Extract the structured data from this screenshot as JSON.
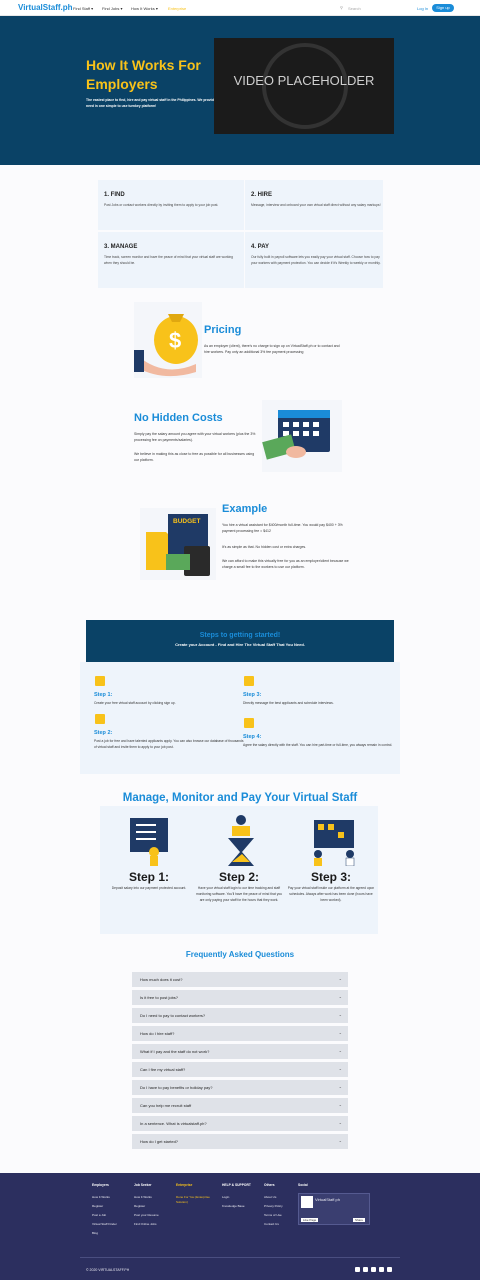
{
  "nav": {
    "logo_a": "Virtual",
    "logo_b": "Staff.ph",
    "menu": [
      "Find Staff ▾",
      "Find Jobs ▾",
      "How It Works ▾",
      "Enterprise"
    ],
    "search_placeholder": "Search",
    "login": "Log In",
    "signup": "Sign up"
  },
  "hero": {
    "title": "How It Works For Employers",
    "subtitle": "The easiest place to find, hire and pay virtual staff in the Philippines. We provide everything you need in one simple to use turnkey platform!",
    "video": "VIDEO PLACEHOLDER"
  },
  "cards": [
    {
      "title": "1. FIND",
      "text": "Post Jobs or contact workers directly by inviting them to apply to your job post."
    },
    {
      "title": "2. HIRE",
      "text": "Message, interview and onboard your own virtual staff direct without any salary markups!"
    },
    {
      "title": "3. MANAGE",
      "text": "Time track, screen monitor and have the peace of mind that your virtual staff are working when they should be."
    },
    {
      "title": "4. PAY",
      "text": "Our fully built in payroll software lets you easily pay your virtual staff. Choose how to pay your workers with payment protection. You can decide if it's Weekly to weekly or monthly."
    }
  ],
  "pricing": {
    "title": "Pricing",
    "text": "As an employer (client), there's no charge to sign up on VirtualStaff.ph or to contact and hire workers. Pay only an additional 3% fee payment processing"
  },
  "hidden": {
    "title": "No Hidden Costs",
    "p1": "Simply pay the salary amount you agree with your virtual workers (plus the 3% processing fee on payments/salaries).",
    "p2": "We believe in making this as close to free as possible for all businesses using our platform."
  },
  "example": {
    "title": "Example",
    "p1": "You hire a virtual assistant for $400/month full-time. You would pay $400 + 3% payment processing fee = $412",
    "p2": "It's as simple as that. No hidden cost or extra charges.",
    "p3": "We can afford to make this virtually free for you as an employer/client because we charge a small fee to the workers to use our platform.",
    "budget": "BUDGET"
  },
  "getting": {
    "title": "Steps to getting started!",
    "sub": "Create your Account - Find and Hire The Virtual Staff That You Need.",
    "steps": [
      {
        "h": "Step 1:",
        "t": "Create your free virtual staff account by clicking sign up."
      },
      {
        "h": "Step 2:",
        "t": "Post a job for free and have talented applicants apply. You can also browse our database of thousands of virtual staff and invite them to apply to your job post."
      },
      {
        "h": "Step 3:",
        "t": "Directly message the best applicants and schedule interviews."
      },
      {
        "h": "Step 4:",
        "t": "Agree the salary directly with the staff. You can hire part-time or full-time, you always remain in control."
      }
    ]
  },
  "manage": {
    "title": "Manage, Monitor and Pay Your Virtual Staff",
    "steps": [
      {
        "h": "Step 1:",
        "t": "Deposit salary into our payment protected account."
      },
      {
        "h": "Step 2:",
        "t": "Have your virtual staff login to our time tracking and staff monitoring software. You'll have the peace of mind that you are only paying your staff for the hours that they work."
      },
      {
        "h": "Step 3:",
        "t": "Pay your virtual staff inside our platform at the agreed upon schedules. Always after work has been done (hours have been worked)."
      }
    ]
  },
  "faq": {
    "title": "Frequently Asked Questions",
    "items": [
      "How much does it cost?",
      "Is it free to post jobs?",
      "Do I need to pay to contact workers?",
      "How do I hire staff?",
      "What if I pay and the staff do not work?",
      "Can I fire my virtual staff?",
      "Do I have to pay benefits or holiday pay?",
      "Can you help me recruit staff",
      "In a sentence. What is virtualstaff.ph?",
      "How do I get started?"
    ]
  },
  "footer": {
    "cols": [
      {
        "h": "Employers",
        "links": [
          "How It Works",
          "Register",
          "Post a Job",
          "Virtual Staff Finder",
          "Blog"
        ]
      },
      {
        "h": "Job Seeker",
        "links": [
          "How It Works",
          "Register",
          "Post your Resume",
          "Find Online Jobs"
        ]
      },
      {
        "h": "Enterprise",
        "links": [
          "Done For You (Enterprise Solution)"
        ]
      },
      {
        "h": "HELP & SUPPORT",
        "links": [
          "Login",
          "Knowledge Base"
        ]
      },
      {
        "h": "Others",
        "links": [
          "About Us",
          "Privacy Policy",
          "Terms of Use",
          "Contact Us"
        ]
      },
      {
        "h": "Social",
        "links": []
      }
    ],
    "fb_name": "VirtualStaff.ph",
    "fb_like": "Like Page",
    "fb_share": "Share",
    "copyright": "© 2020 VIRTUALSTAFF.PH"
  },
  "colors": {
    "navy": "#0a4266",
    "accent": "#1a8cd8",
    "yellow": "#f8c21a",
    "footer": "#2c2f5f"
  }
}
